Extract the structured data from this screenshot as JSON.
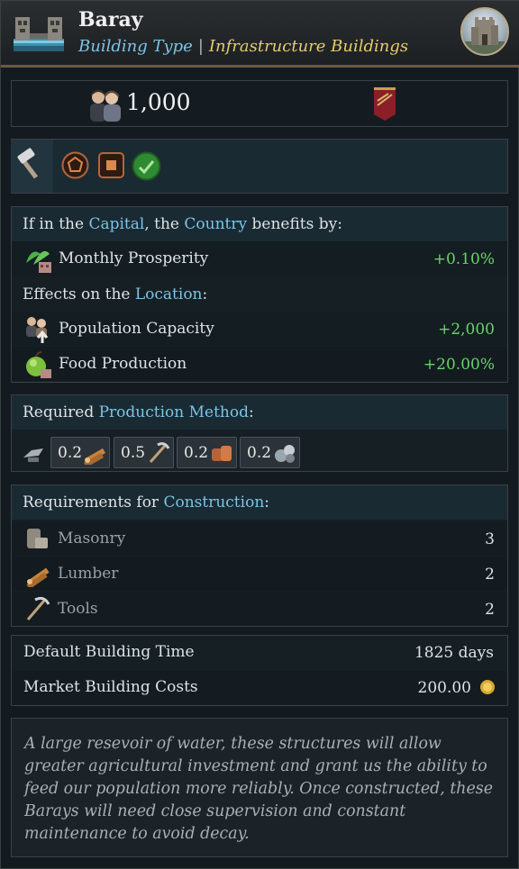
{
  "header": {
    "title": "Baray",
    "subtitle_type": "Building Type",
    "subtitle_sep": "|",
    "subtitle_category": "Infrastructure Buildings",
    "icon": "baray-building-icon",
    "portrait_icon": "castle-portrait-icon"
  },
  "population": {
    "value": "1,000",
    "icon": "population-icon",
    "banner_icon": "banner-icon"
  },
  "icons_row": [
    "hammer-icon",
    "pentagon-icon",
    "square-icon",
    "green-check-icon"
  ],
  "capital": {
    "heading": {
      "pre": "If in the",
      "capital": "Capital",
      "mid": ", the",
      "country": "Country",
      "post": "benefits by:"
    },
    "items": [
      {
        "label": "Monthly Prosperity",
        "value": "+0.10%",
        "icon": "prosperity-icon"
      }
    ]
  },
  "location": {
    "heading": {
      "pre": "Effects on the",
      "location": "Location",
      "post": ":"
    },
    "items": [
      {
        "label": "Population Capacity",
        "value": "+2,000",
        "icon": "population-capacity-icon"
      },
      {
        "label": "Food Production",
        "value": "+20.00%",
        "icon": "apple-icon"
      }
    ]
  },
  "production": {
    "heading": {
      "pre": "Required",
      "method": "Production Method",
      "post": ":"
    },
    "goods": [
      {
        "value": "0.2",
        "icon": "lumber-icon"
      },
      {
        "value": "0.5",
        "icon": "tools-icon"
      },
      {
        "value": "0.2",
        "icon": "clay-icon"
      },
      {
        "value": "0.2",
        "icon": "stone-icon"
      }
    ]
  },
  "construction": {
    "heading": {
      "pre": "Requirements for",
      "construction": "Construction",
      "post": ":"
    },
    "items": [
      {
        "label": "Masonry",
        "value": "3",
        "icon": "masonry-icon"
      },
      {
        "label": "Lumber",
        "value": "2",
        "icon": "lumber-icon"
      },
      {
        "label": "Tools",
        "value": "2",
        "icon": "tools-icon"
      }
    ]
  },
  "building_time": {
    "label": "Default Building Time",
    "value": "1825 days"
  },
  "market_cost": {
    "label": "Market Building Costs",
    "value": "200.00",
    "icon": "gold-coin-icon"
  },
  "description": "A large resevoir of water, these structures will allow greater agricultural investment and grant us the ability to feed our population more reliably. Once constructed, these Barays will need close supervision and constant maintenance to avoid decay.",
  "colors": {
    "accent_blue": "#7cc4e6",
    "accent_gold": "#e8cc6a",
    "positive_green": "#6ad36a"
  }
}
